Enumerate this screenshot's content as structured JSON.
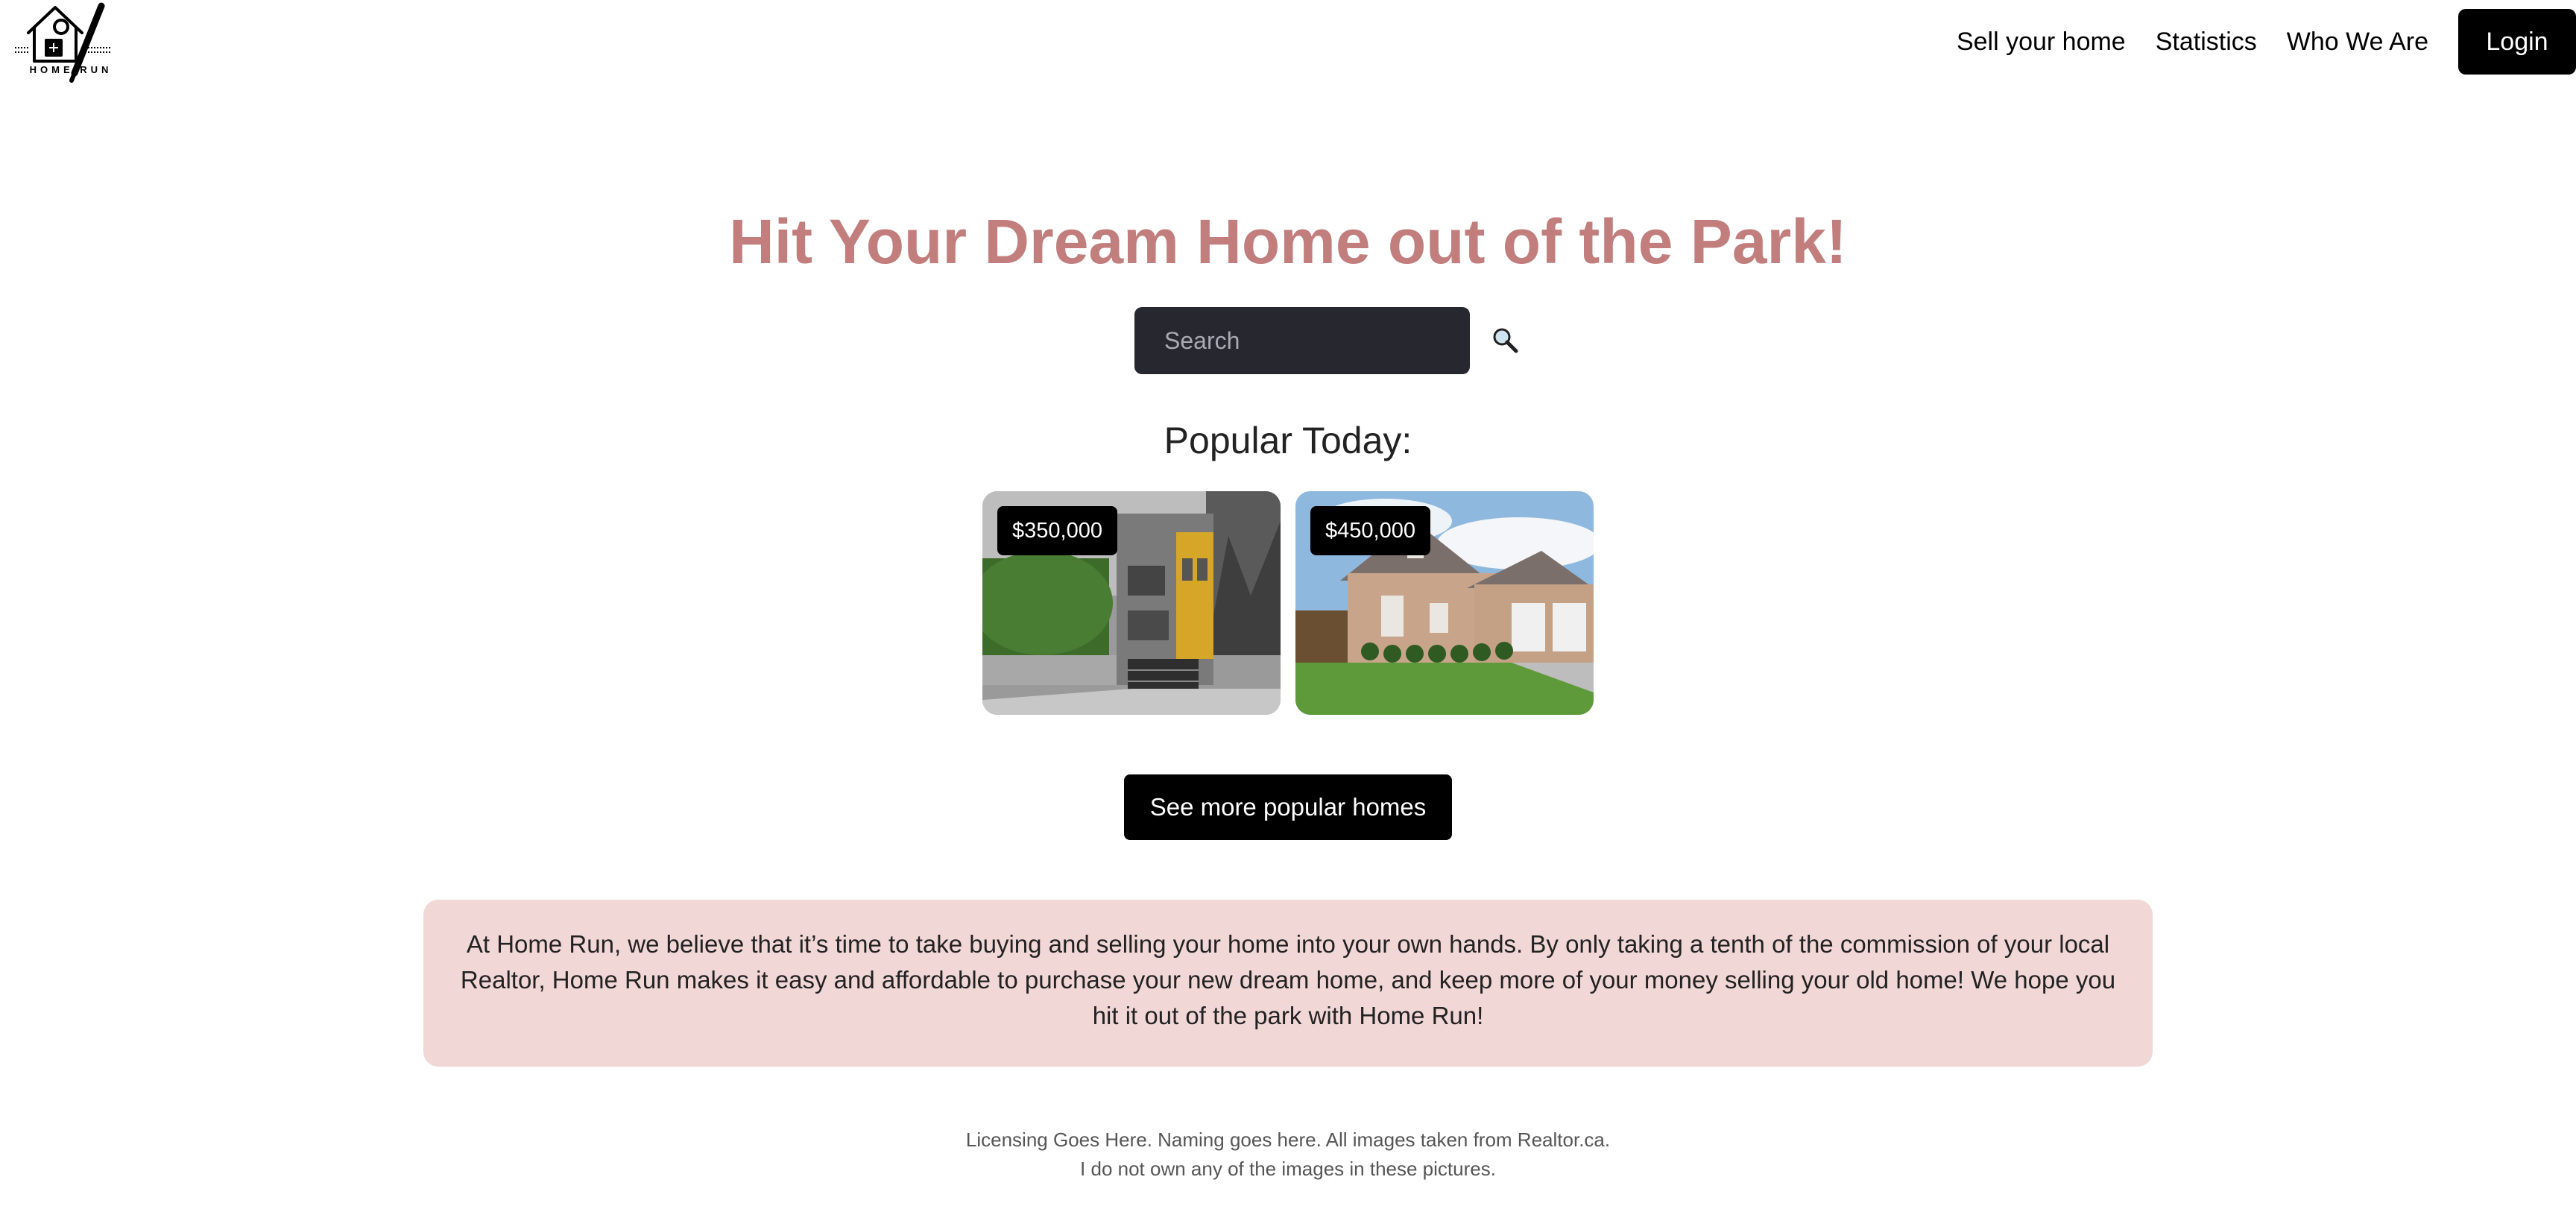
{
  "header": {
    "logo_text": "HOME RUN",
    "nav": [
      {
        "label": "Sell your home"
      },
      {
        "label": "Statistics"
      },
      {
        "label": "Who We Are"
      }
    ],
    "login_label": "Login"
  },
  "hero": {
    "title": "Hit Your Dream Home out of the Park!",
    "title_color": "#c27d7d",
    "search": {
      "placeholder": "Search",
      "value": "",
      "icon": "magnifying-glass-icon"
    }
  },
  "popular": {
    "heading": "Popular Today:",
    "listings": [
      {
        "price": "$350,000",
        "image": "modern-grey-house-with-yellow-accent"
      },
      {
        "price": "$450,000",
        "image": "brick-two-storey-house-with-garage"
      }
    ],
    "more_button": "See more popular homes"
  },
  "about": {
    "text": "At Home Run, we believe that it’s time to take buying and selling your home into your own hands. By only taking a tenth of the commission of your local Realtor, Home Run makes it easy and affordable to purchase your new dream home, and keep more of your money selling your old home! We hope you hit it out of the park with Home Run!",
    "background": "#f2d7d7"
  },
  "footer": {
    "line1": "Licensing Goes Here. Naming goes here. All images taken from Realtor.ca.",
    "line2": "I do not own any of the images in these pictures."
  }
}
